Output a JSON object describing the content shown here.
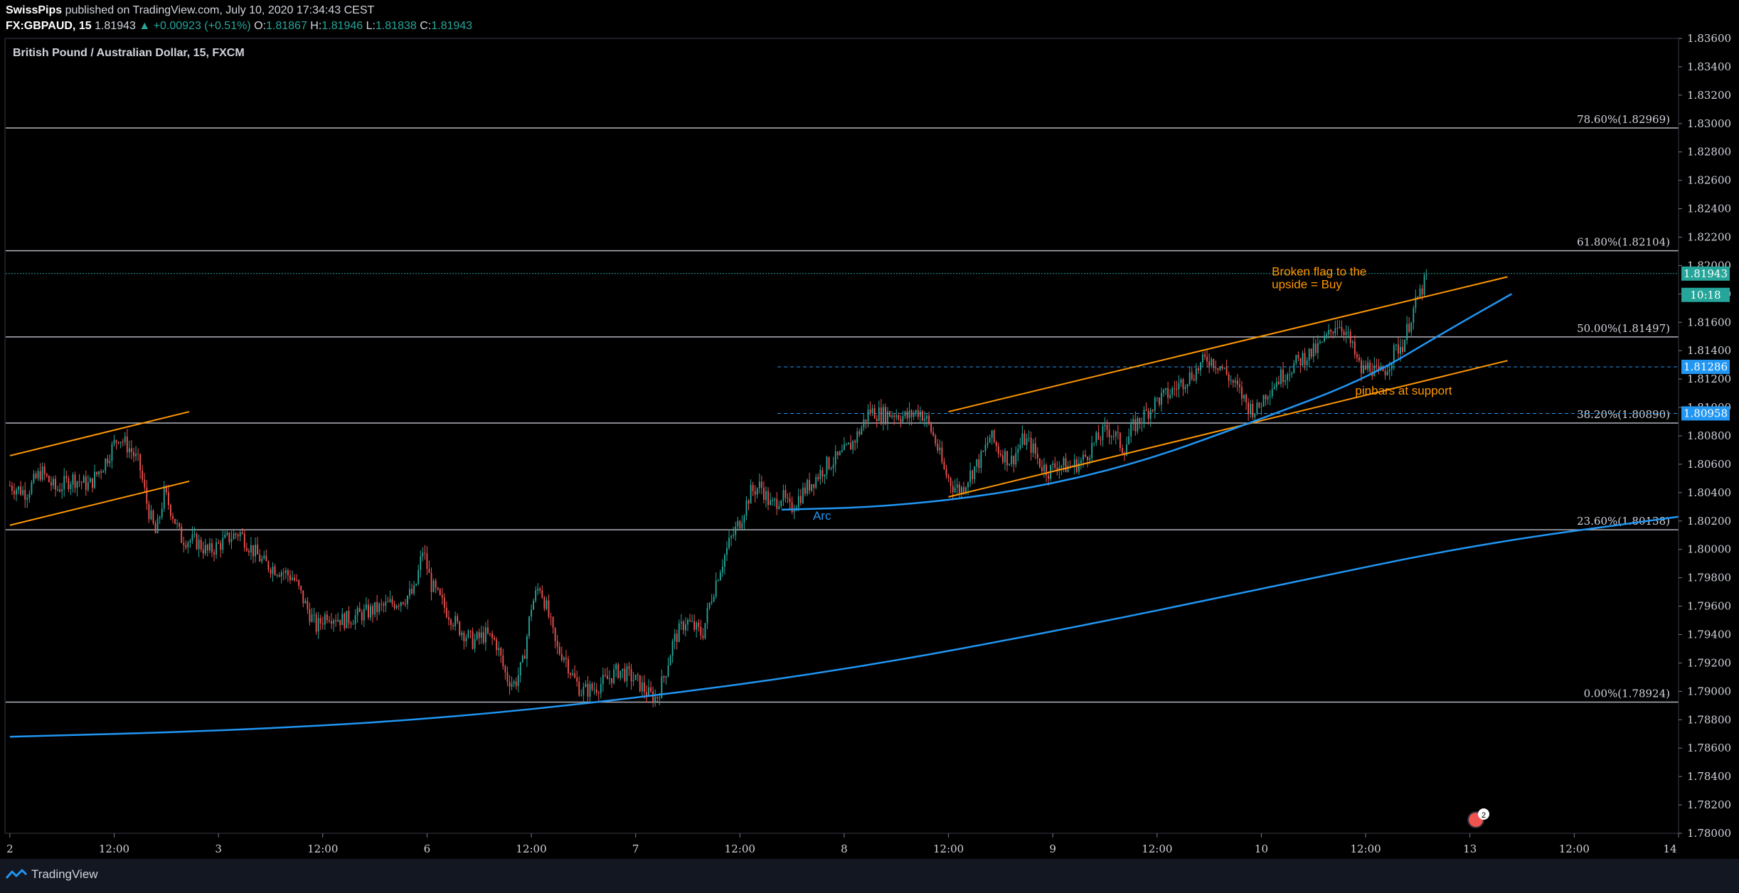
{
  "header": {
    "author": "SwissPips",
    "published": "published on TradingView.com, July 10, 2020 17:34:43 CEST",
    "symbol": "FX:GBPAUD, 15",
    "last": "1.81943",
    "change": "+0.00923 (+0.51%)",
    "ohlc": [
      {
        "label": "O:",
        "value": "1.81867"
      },
      {
        "label": "H:",
        "value": "1.81946"
      },
      {
        "label": "L:",
        "value": "1.81838"
      },
      {
        "label": "C:",
        "value": "1.81943"
      }
    ]
  },
  "chart_title": "British Pound / Australian Dollar, 15, FXCM",
  "footer": {
    "brand": "TradingView"
  },
  "colors": {
    "up": "#26a69a",
    "down": "#ef5350",
    "bg": "#000000",
    "orange": "#ff9800",
    "blue": "#2196f3",
    "fib": "#b2b5be",
    "axis_text": "#d1d4dc"
  },
  "chart_data": {
    "type": "candlestick",
    "ylim": [
      1.78,
      1.836
    ],
    "y_ticks": [
      "1.78000",
      "1.78200",
      "1.78400",
      "1.78600",
      "1.78800",
      "1.79000",
      "1.79200",
      "1.79400",
      "1.79600",
      "1.79800",
      "1.80000",
      "1.80200",
      "1.80400",
      "1.80600",
      "1.80800",
      "1.81000",
      "1.81200",
      "1.81400",
      "1.81600",
      "1.81800",
      "1.82000",
      "1.82200",
      "1.82400",
      "1.82600",
      "1.82800",
      "1.83000",
      "1.83200",
      "1.83400",
      "1.83600"
    ],
    "x_ticks": [
      {
        "label": "2",
        "x": 0.0
      },
      {
        "label": "12:00",
        "x": 0.5
      },
      {
        "label": "3",
        "x": 1.0
      },
      {
        "label": "12:00",
        "x": 1.5
      },
      {
        "label": "6",
        "x": 2.0
      },
      {
        "label": "12:00",
        "x": 2.5
      },
      {
        "label": "7",
        "x": 3.0
      },
      {
        "label": "12:00",
        "x": 3.5
      },
      {
        "label": "8",
        "x": 4.0
      },
      {
        "label": "12:00",
        "x": 4.5
      },
      {
        "label": "9",
        "x": 5.0
      },
      {
        "label": "12:00",
        "x": 5.5
      },
      {
        "label": "10",
        "x": 6.0
      },
      {
        "label": "12:00",
        "x": 6.5
      },
      {
        "label": "13",
        "x": 7.0
      },
      {
        "label": "12:00",
        "x": 7.5
      },
      {
        "label": "14",
        "x": 8.0
      }
    ],
    "xlim": [
      -0.02,
      8.0
    ],
    "price_path": [
      [
        0.0,
        1.8045
      ],
      [
        0.08,
        1.804
      ],
      [
        0.15,
        1.8055
      ],
      [
        0.22,
        1.8042
      ],
      [
        0.3,
        1.805
      ],
      [
        0.38,
        1.8045
      ],
      [
        0.45,
        1.806
      ],
      [
        0.52,
        1.808
      ],
      [
        0.58,
        1.807
      ],
      [
        0.62,
        1.806
      ],
      [
        0.66,
        1.803
      ],
      [
        0.7,
        1.801
      ],
      [
        0.74,
        1.804
      ],
      [
        0.78,
        1.8025
      ],
      [
        0.82,
        1.8008
      ],
      [
        0.9,
        1.8005
      ],
      [
        0.95,
        1.7998
      ],
      [
        1.0,
        1.8003
      ],
      [
        1.05,
        1.8008
      ],
      [
        1.1,
        1.8012
      ],
      [
        1.15,
        1.8002
      ],
      [
        1.22,
        1.799
      ],
      [
        1.3,
        1.7985
      ],
      [
        1.36,
        1.798
      ],
      [
        1.42,
        1.796
      ],
      [
        1.47,
        1.7945
      ],
      [
        1.52,
        1.7955
      ],
      [
        1.6,
        1.795
      ],
      [
        1.7,
        1.7955
      ],
      [
        1.8,
        1.796
      ],
      [
        1.88,
        1.7965
      ],
      [
        1.94,
        1.797
      ],
      [
        1.98,
        1.8
      ],
      [
        2.02,
        1.7975
      ],
      [
        2.08,
        1.796
      ],
      [
        2.15,
        1.7945
      ],
      [
        2.22,
        1.7935
      ],
      [
        2.28,
        1.794
      ],
      [
        2.33,
        1.7935
      ],
      [
        2.38,
        1.791
      ],
      [
        2.42,
        1.7905
      ],
      [
        2.46,
        1.792
      ],
      [
        2.5,
        1.796
      ],
      [
        2.54,
        1.7975
      ],
      [
        2.58,
        1.7955
      ],
      [
        2.62,
        1.793
      ],
      [
        2.66,
        1.7925
      ],
      [
        2.7,
        1.791
      ],
      [
        2.74,
        1.79
      ],
      [
        2.8,
        1.7902
      ],
      [
        2.86,
        1.7908
      ],
      [
        2.92,
        1.7915
      ],
      [
        2.98,
        1.791
      ],
      [
        3.02,
        1.7905
      ],
      [
        3.06,
        1.7898
      ],
      [
        3.1,
        1.7895
      ],
      [
        3.14,
        1.7912
      ],
      [
        3.18,
        1.7935
      ],
      [
        3.24,
        1.795
      ],
      [
        3.28,
        1.7945
      ],
      [
        3.32,
        1.794
      ],
      [
        3.36,
        1.7965
      ],
      [
        3.4,
        1.7985
      ],
      [
        3.45,
        1.8005
      ],
      [
        3.5,
        1.802
      ],
      [
        3.55,
        1.804
      ],
      [
        3.6,
        1.8045
      ],
      [
        3.65,
        1.803
      ],
      [
        3.7,
        1.8038
      ],
      [
        3.74,
        1.8028
      ],
      [
        3.8,
        1.804
      ],
      [
        3.86,
        1.805
      ],
      [
        3.92,
        1.806
      ],
      [
        3.98,
        1.8065
      ],
      [
        4.04,
        1.8075
      ],
      [
        4.08,
        1.8085
      ],
      [
        4.12,
        1.8098
      ],
      [
        4.18,
        1.8095
      ],
      [
        4.24,
        1.8096
      ],
      [
        4.3,
        1.8093
      ],
      [
        4.36,
        1.8098
      ],
      [
        4.4,
        1.809
      ],
      [
        4.44,
        1.8075
      ],
      [
        4.48,
        1.8055
      ],
      [
        4.52,
        1.8045
      ],
      [
        4.56,
        1.8042
      ],
      [
        4.6,
        1.8052
      ],
      [
        4.66,
        1.8065
      ],
      [
        4.7,
        1.808
      ],
      [
        4.74,
        1.807
      ],
      [
        4.8,
        1.8062
      ],
      [
        4.86,
        1.8078
      ],
      [
        4.9,
        1.8072
      ],
      [
        4.94,
        1.806
      ],
      [
        4.98,
        1.8055
      ],
      [
        5.02,
        1.806
      ],
      [
        5.08,
        1.8058
      ],
      [
        5.14,
        1.8062
      ],
      [
        5.2,
        1.8075
      ],
      [
        5.26,
        1.8085
      ],
      [
        5.3,
        1.808
      ],
      [
        5.34,
        1.807
      ],
      [
        5.38,
        1.8085
      ],
      [
        5.44,
        1.8095
      ],
      [
        5.5,
        1.8105
      ],
      [
        5.56,
        1.811
      ],
      [
        5.62,
        1.8118
      ],
      [
        5.68,
        1.8125
      ],
      [
        5.74,
        1.8135
      ],
      [
        5.8,
        1.813
      ],
      [
        5.86,
        1.8118
      ],
      [
        5.9,
        1.811
      ],
      [
        5.94,
        1.81
      ],
      [
        5.98,
        1.8098
      ],
      [
        6.02,
        1.811
      ],
      [
        6.08,
        1.812
      ],
      [
        6.14,
        1.8128
      ],
      [
        6.2,
        1.8135
      ],
      [
        6.26,
        1.814
      ],
      [
        6.32,
        1.815
      ],
      [
        6.36,
        1.816
      ],
      [
        6.4,
        1.8155
      ],
      [
        6.44,
        1.814
      ],
      [
        6.48,
        1.8125
      ],
      [
        6.52,
        1.813
      ],
      [
        6.56,
        1.8122
      ],
      [
        6.6,
        1.8128
      ],
      [
        6.64,
        1.814
      ],
      [
        6.68,
        1.8145
      ],
      [
        6.72,
        1.8165
      ],
      [
        6.76,
        1.818
      ],
      [
        6.8,
        1.8194
      ]
    ],
    "fib_levels": [
      {
        "label": "78.60%(1.82969)",
        "price": 1.82969
      },
      {
        "label": "61.80%(1.82104)",
        "price": 1.82104
      },
      {
        "label": "50.00%(1.81497)",
        "price": 1.81497
      },
      {
        "label": "38.20%(1.80890)",
        "price": 1.8089
      },
      {
        "label": "23.60%(1.80138)",
        "price": 1.80138
      },
      {
        "label": "0.00%(1.78924)",
        "price": 1.78924
      }
    ],
    "price_markers": [
      {
        "label": "1.81943",
        "price": 1.81943,
        "color": "#26a69a"
      },
      {
        "label": "10:18",
        "price": 1.81793,
        "color": "#26a69a"
      },
      {
        "label": "1.81286",
        "price": 1.81286,
        "color": "#2196f3"
      },
      {
        "label": "1.80958",
        "price": 1.80958,
        "color": "#2196f3"
      }
    ],
    "h_dashed": [
      1.81286,
      1.80958
    ],
    "current_price": 1.81943,
    "trendlines": [
      {
        "x1": 0.0,
        "y1": 1.8066,
        "x2": 0.86,
        "y2": 1.8097
      },
      {
        "x1": 0.0,
        "y1": 1.8017,
        "x2": 0.86,
        "y2": 1.8048
      },
      {
        "x1": 4.5,
        "y1": 1.8097,
        "x2": 7.18,
        "y2": 1.8192
      },
      {
        "x1": 4.5,
        "y1": 1.8037,
        "x2": 7.18,
        "y2": 1.8133
      }
    ],
    "arcs": [
      {
        "points": [
          [
            3.7,
            1.8028
          ],
          [
            4.2,
            1.803
          ],
          [
            4.8,
            1.804
          ],
          [
            5.4,
            1.806
          ],
          [
            6.0,
            1.8092
          ],
          [
            6.5,
            1.812
          ],
          [
            6.9,
            1.8155
          ],
          [
            7.2,
            1.818
          ]
        ]
      },
      {
        "points": [
          [
            0.0,
            1.7868
          ],
          [
            1.0,
            1.7872
          ],
          [
            2.0,
            1.788
          ],
          [
            3.0,
            1.7895
          ],
          [
            4.0,
            1.7915
          ],
          [
            5.0,
            1.7942
          ],
          [
            6.0,
            1.7972
          ],
          [
            7.0,
            1.8003
          ],
          [
            8.0,
            1.8023
          ]
        ]
      }
    ],
    "annotations": [
      {
        "text": "Broken flag to the",
        "x": 6.05,
        "y": 1.8193,
        "color": "#ff9800"
      },
      {
        "text": "upside = Buy",
        "x": 6.05,
        "y": 1.8184,
        "color": "#ff9800"
      },
      {
        "text": "pinbars at support",
        "x": 6.45,
        "y": 1.8109,
        "color": "#ff9800"
      },
      {
        "text": "Arc",
        "x": 3.85,
        "y": 1.8021,
        "color": "#2196f3"
      }
    ]
  }
}
